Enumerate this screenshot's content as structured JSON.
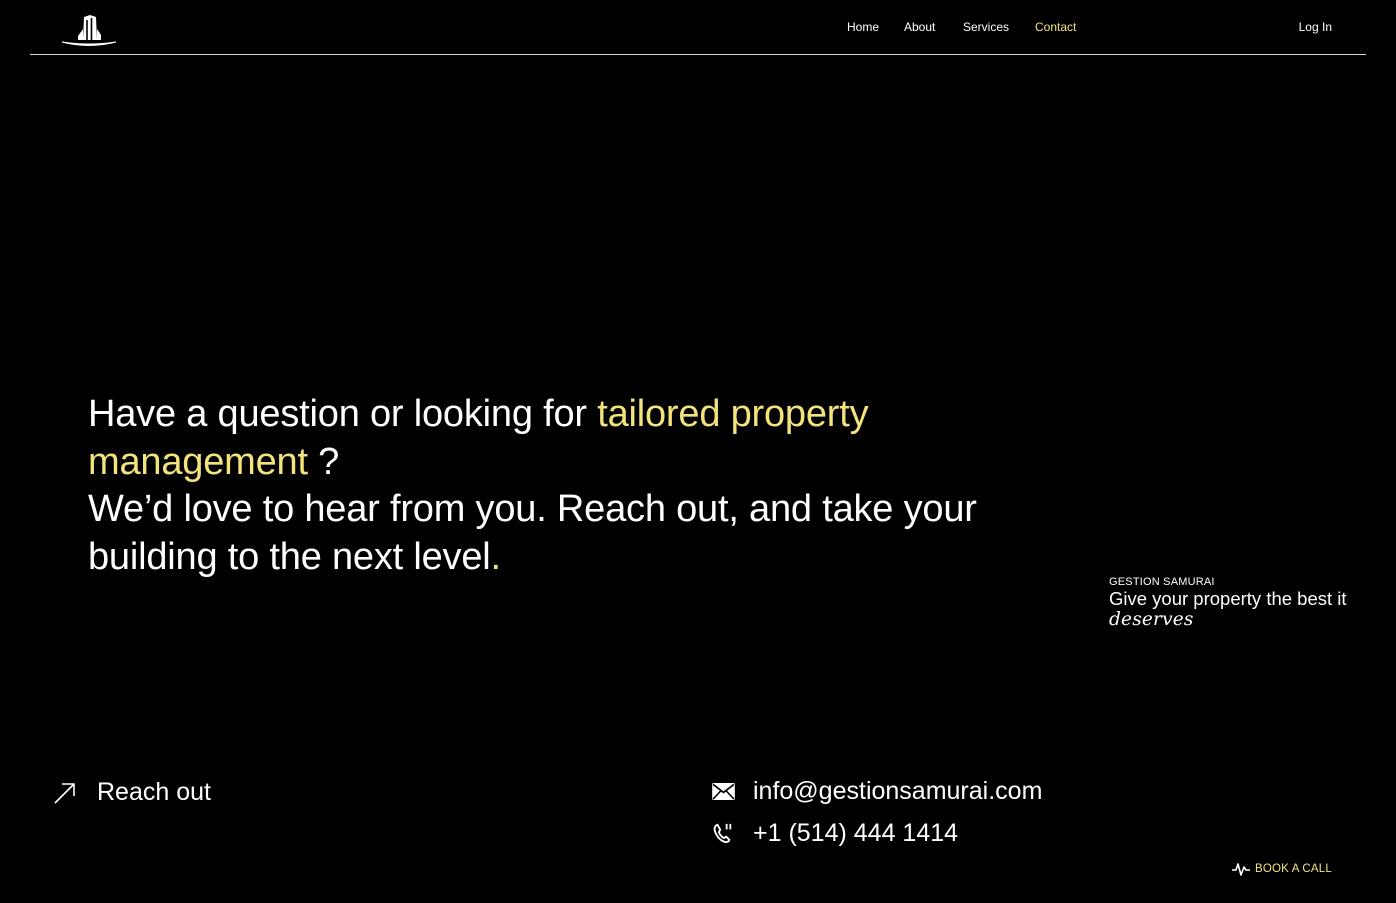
{
  "header": {
    "logo_icon": "samurai-hat-logo",
    "nav": [
      {
        "label": "Home",
        "active": false
      },
      {
        "label": "About",
        "active": false
      },
      {
        "label": "Services",
        "active": false
      },
      {
        "label": "Contact",
        "active": true
      }
    ],
    "login_label": "Log In"
  },
  "hero": {
    "line1_plain": "Have a question or looking for ",
    "line1_highlight": "tailored property management",
    "line1_end": " ?",
    "line2": "We’d love to hear from you. Reach out, and take your building to the next level",
    "line2_period": "."
  },
  "tagline": {
    "brand": "GESTION SAMURAI",
    "slogan": "Give your property the best it",
    "slogan_italic": "deserves"
  },
  "reach": {
    "icon": "arrow-up-right-icon",
    "label": "Reach out"
  },
  "contact": {
    "email_icon": "mail-icon",
    "email": "info@gestionsamurai.com",
    "phone_icon": "phone-icon",
    "phone": "+1 (514) 444 1414"
  },
  "book_call": {
    "icon": "pulse-icon",
    "label": "BOOK A CALL"
  },
  "colors": {
    "background": "#000000",
    "text": "#ffffff",
    "accent": "#f3e37c"
  }
}
